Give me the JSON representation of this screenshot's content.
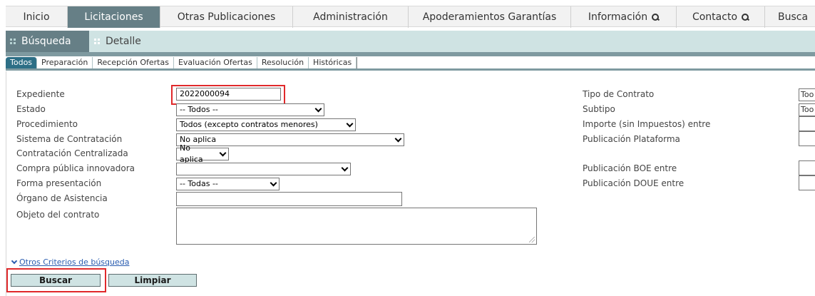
{
  "topnav": {
    "items": [
      {
        "label": "Inicio"
      },
      {
        "label": "Licitaciones",
        "active": true
      },
      {
        "label": "Otras Publicaciones"
      },
      {
        "label": "Administración"
      },
      {
        "label": "Apoderamientos Garantías"
      },
      {
        "label": "Información",
        "icon": "search-icon"
      },
      {
        "label": "Contacto",
        "icon": "search-icon"
      },
      {
        "label": "Busca"
      }
    ]
  },
  "subnav": {
    "items": [
      {
        "label": "Búsqueda",
        "active": true
      },
      {
        "label": "Detalle"
      }
    ]
  },
  "tabs": [
    "Todos",
    "Preparación",
    "Recepción Ofertas",
    "Evaluación Ofertas",
    "Resolución",
    "Históricas"
  ],
  "form": {
    "expediente": {
      "label": "Expediente",
      "value": "2022000094"
    },
    "estado": {
      "label": "Estado",
      "value": "-- Todos --"
    },
    "procedimiento": {
      "label": "Procedimiento",
      "value": "Todos (excepto contratos menores)"
    },
    "sistema": {
      "label": "Sistema de Contratación",
      "value": "No aplica"
    },
    "centralizada": {
      "label": "Contratación Centralizada",
      "value": "No aplica"
    },
    "compra": {
      "label": "Compra pública innovadora",
      "value": ""
    },
    "forma": {
      "label": "Forma presentación",
      "value": "-- Todas --"
    },
    "organo": {
      "label": "Órgano de Asistencia",
      "value": ""
    },
    "objeto": {
      "label": "Objeto del contrato",
      "value": ""
    },
    "tipo_contrato": {
      "label": "Tipo de Contrato",
      "value": "Too"
    },
    "subtipo": {
      "label": "Subtipo",
      "value": "Too"
    },
    "importe": {
      "label": "Importe (sin Impuestos) entre"
    },
    "pub_plataforma": {
      "label": "Publicación Plataforma"
    },
    "pub_boe": {
      "label": "Publicación BOE entre"
    },
    "pub_doue": {
      "label": "Publicación DOUE entre"
    }
  },
  "otros_criterios": "Otros Criterios de búsqueda",
  "buttons": {
    "buscar": "Buscar",
    "limpiar": "Limpiar"
  },
  "colors": {
    "accent": "#667f86",
    "subnav_bg": "#cfe3e3",
    "highlight": "#e0292b",
    "link": "#2a5db0"
  }
}
